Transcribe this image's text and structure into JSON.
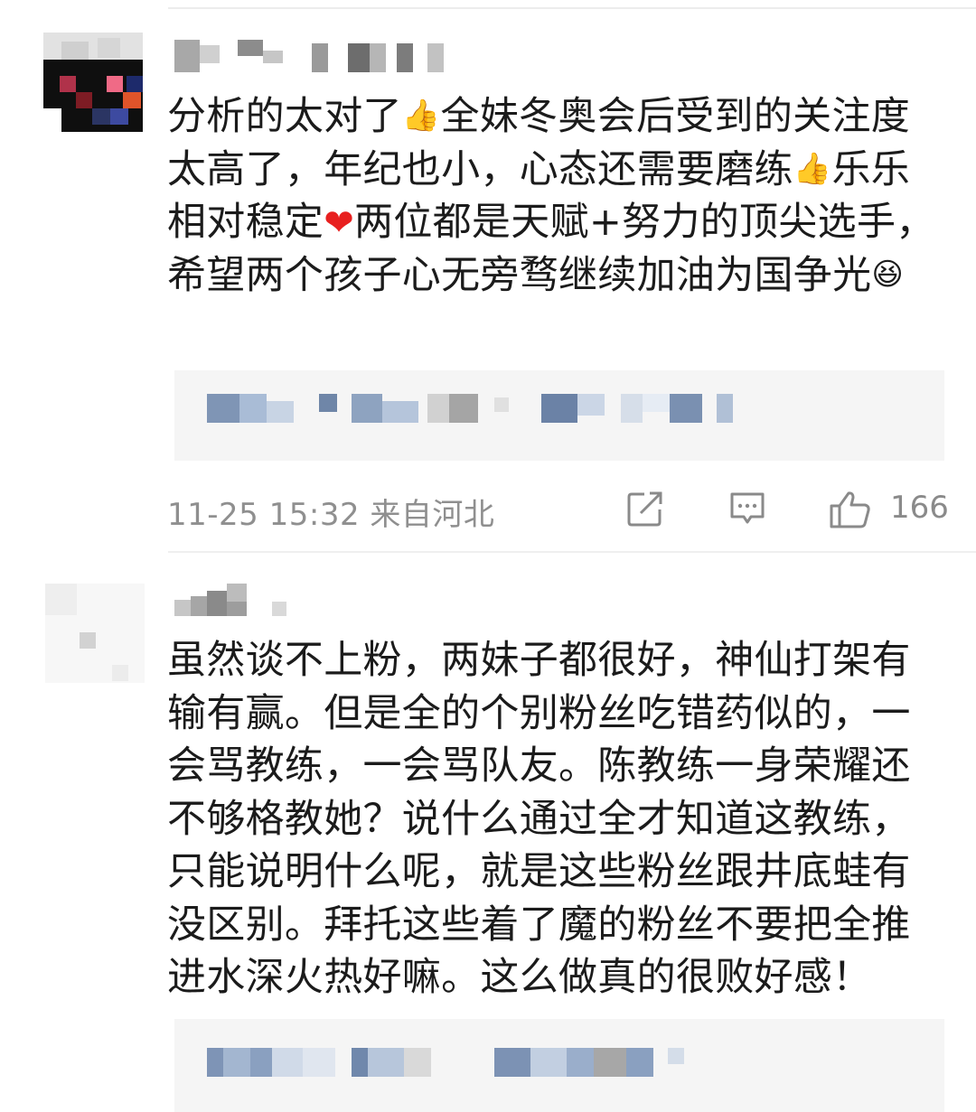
{
  "comments": [
    {
      "text_parts": [
        "分析的太对了",
        "全妹冬奥会后受到的关注度太高了，年纪也小，心态还需要磨练",
        "乐乐相对稳定",
        "两位都是天赋+努力的顶尖选手，希望两个孩子心无旁骛继续加油为国争光"
      ],
      "emojis": [
        "👍",
        "👍",
        "❤",
        "😆"
      ],
      "timestamp": "11-25 15:32 来自河北",
      "like_count": "166"
    },
    {
      "text": "虽然谈不上粉，两妹子都很好，神仙打架有输有赢。但是全的个别粉丝吃错药似的，一会骂教练，一会骂队友。陈教练一身荣耀还不够格教她？说什么通过全才知道这教练，只能说明什么呢，就是这些粉丝跟井底蛙有没区别。拜托这些着了魔的粉丝不要把全推进水深火热好嘛。这么做真的很败好感！"
    }
  ],
  "icons": {
    "share": "share-icon",
    "comment": "comment-icon",
    "like": "thumbs-up-icon"
  },
  "colors": {
    "meta_text": "#8f8f8f",
    "heart": "#e8201f",
    "reply_background": "#f5f5f5"
  }
}
